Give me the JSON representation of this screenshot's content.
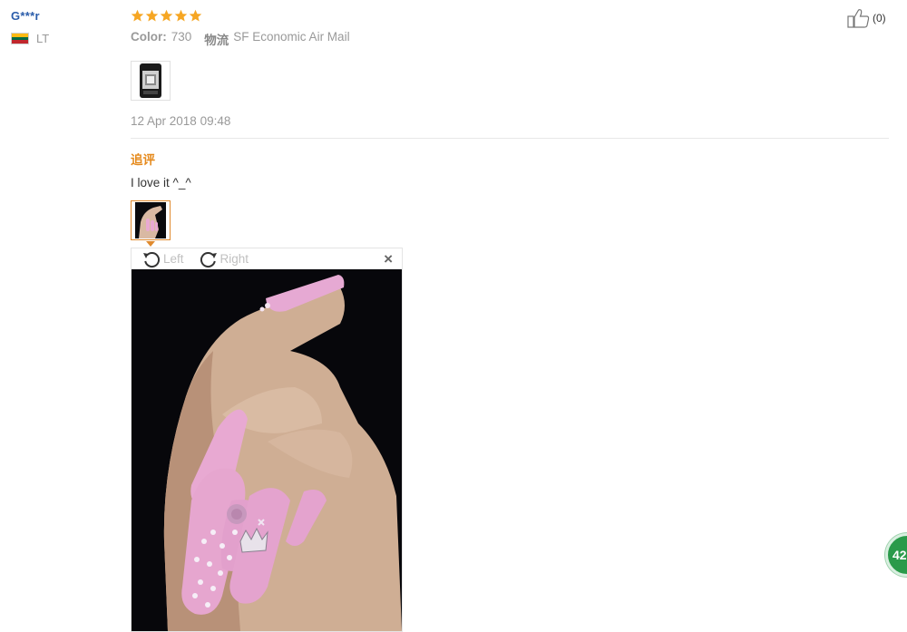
{
  "user": {
    "name": "G***r",
    "country_code": "LT",
    "flag_colors": [
      "#fdb913",
      "#006a44",
      "#c1272d"
    ]
  },
  "review": {
    "rating": 5,
    "star_color": "#f6a623",
    "color_label": "Color:",
    "color_value": "730",
    "shipping_label": "物流",
    "shipping_value": "SF Economic Air Mail",
    "date": "12 Apr 2018 09:48",
    "likes": "(0)"
  },
  "followup": {
    "label": "追评",
    "label_color": "#e5891b",
    "text": "I love it ^_^"
  },
  "viewer": {
    "rotate_left_label": "Left",
    "rotate_right_label": "Right",
    "close_label": "×"
  },
  "float_badge": {
    "text": "42"
  },
  "icons": [
    "star-icon",
    "thumbs-up-icon",
    "rotate-left-icon",
    "rotate-right-icon",
    "close-icon"
  ]
}
